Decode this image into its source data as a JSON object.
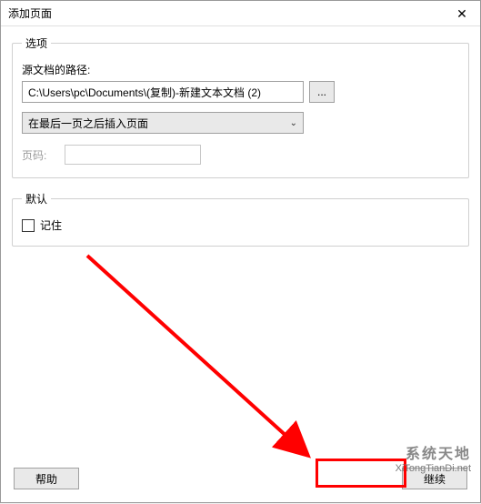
{
  "window": {
    "title": "添加页面",
    "close_label": "✕"
  },
  "options_group": {
    "legend": "选项",
    "source_path_label": "源文档的路径:",
    "source_path_value": "C:\\Users\\pc\\Documents\\(复制)-新建文本文档 (2)",
    "browse_label": "...",
    "insert_position_value": "在最后一页之后插入页面",
    "chevron": "⌄",
    "page_label": "页码:"
  },
  "defaults_group": {
    "legend": "默认",
    "remember_label": "记住"
  },
  "footer": {
    "help_label": "帮助",
    "continue_label": "继续"
  },
  "watermark": {
    "line1": "系统天地",
    "line2": "XiTongTianDi.net"
  }
}
